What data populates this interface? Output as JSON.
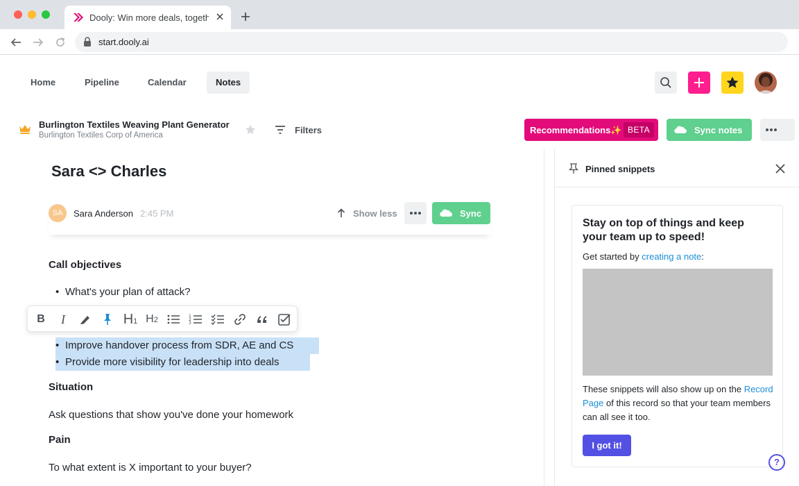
{
  "browser": {
    "tab_title": "Dooly: Win more deals, together",
    "url": "start.dooly.ai"
  },
  "nav": {
    "items": [
      {
        "label": "Home"
      },
      {
        "label": "Pipeline"
      },
      {
        "label": "Calendar"
      },
      {
        "label": "Notes"
      }
    ],
    "active": "Notes"
  },
  "record": {
    "title": "Burlington Textiles Weaving Plant Generator",
    "subtitle": "Burlington Textiles Corp of America",
    "filters_label": "Filters",
    "recommendations_label": "Recommendations✨",
    "beta_label": "BETA",
    "sync_notes_label": "Sync notes"
  },
  "note": {
    "title": "Sara <> Charles",
    "author_initials": "SA",
    "author_name": "Sara Anderson",
    "time": "2:45 PM",
    "show_less_label": "Show less",
    "sync_label": "Sync",
    "sections": {
      "call_objectives": "Call objectives",
      "bullet_1": "What's your plan of attack?",
      "bullet_2": "Improve handover process from SDR, AE and CS",
      "bullet_3": "Provide more visibility for leadership into deals",
      "situation": "Situation",
      "situation_body": "Ask questions that show you've done your homework",
      "pain": "Pain",
      "pain_body": "To what extent is X important to your buyer?"
    },
    "bullet_glyph": "•"
  },
  "format_toolbar": {
    "bold": "B",
    "italic": "I",
    "h1": "H",
    "h1_sub": "1",
    "h2": "H",
    "h2_sub": "2"
  },
  "pinned": {
    "title": "Pinned snippets",
    "heading": "Stay on top of things and keep your team up to speed!",
    "start_prefix": "Get started by ",
    "start_link": "creating a note",
    "start_suffix": ":",
    "desc_prefix": "These snippets will also show up on the ",
    "desc_link": "Record Page",
    "desc_suffix": " of this record so that your team members can all see it too.",
    "button_label": "I got it!",
    "help_label": "?"
  },
  "colors": {
    "brand_pink": "#e30b7a",
    "sync_green": "#5fd08e",
    "primary_purple": "#5350e4",
    "selection_blue": "#c9e1f7"
  }
}
